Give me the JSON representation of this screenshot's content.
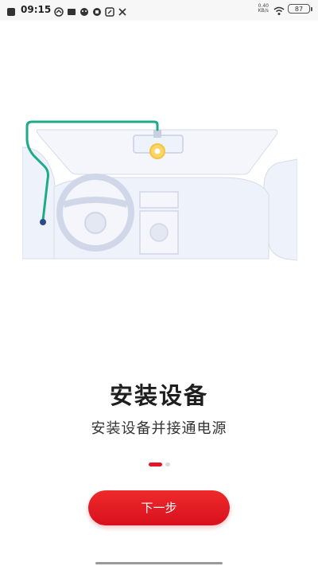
{
  "status_bar": {
    "time": "09:15",
    "net_speed": "0.40",
    "net_unit": "KB/s",
    "battery": "87",
    "icons": [
      "notification-icon",
      "book-icon",
      "chat-icon",
      "pig-icon",
      "square-app-icon",
      "tools-icon",
      "wifi-icon"
    ]
  },
  "page": {
    "title": "安装设备",
    "subtitle": "安装设备并接通电源",
    "pager_total": 2,
    "pager_current": 1,
    "next_button_label": "下一步"
  },
  "colors": {
    "accent": "#e1162a",
    "cable": "#1faa8a",
    "illustration": "#eef2fa"
  }
}
